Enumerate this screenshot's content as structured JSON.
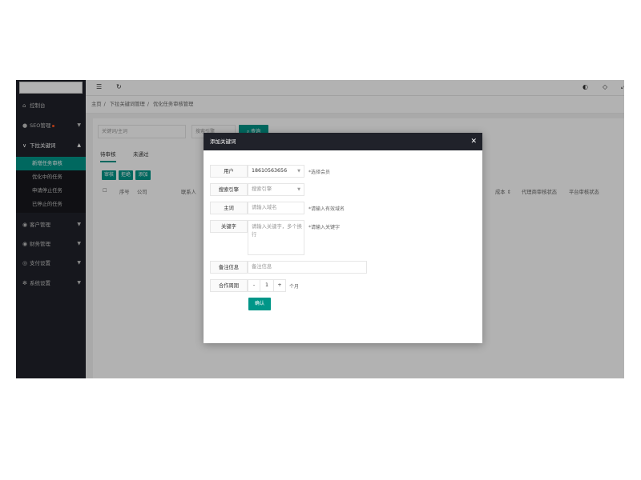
{
  "sidebar": {
    "items": [
      {
        "label": "控制台",
        "icon": "home-icon"
      },
      {
        "label": "SEO管理",
        "icon": "settings-icon"
      },
      {
        "label": "下拉关键词",
        "icon": "chevron-icon"
      },
      {
        "label": "客户管理",
        "icon": "user-icon"
      },
      {
        "label": "财务管理",
        "icon": "finance-icon"
      },
      {
        "label": "支付设置",
        "icon": "pay-icon"
      },
      {
        "label": "系统设置",
        "icon": "gear-icon"
      }
    ],
    "sub_items": [
      "新增任务审核",
      "优化中的任务",
      "申请停止任务",
      "已停止的任务"
    ]
  },
  "breadcrumb": [
    "主页",
    "下拉关键词管理",
    "优化任务审核管理"
  ],
  "toolbar": {
    "search_placeholder": "关键词/主词",
    "engine_placeholder": "搜索引擎",
    "search_button": "查询"
  },
  "tabs": [
    "待审核",
    "未通过"
  ],
  "actions": [
    "审核",
    "拒绝",
    "添加"
  ],
  "table_headers": [
    "序号",
    "公司",
    "联系人",
    "成本",
    "代理商审核状态",
    "平台审核状态"
  ],
  "modal": {
    "title": "添加关键词",
    "user_label": "用户",
    "user_value": "18610563656",
    "user_hint": "*选择会员",
    "engine_label": "搜索引擎",
    "engine_placeholder": "搜索引擎",
    "mainword_label": "主词",
    "mainword_placeholder": "请输入域名",
    "mainword_hint": "*请输入有效域名",
    "keyword_label": "关键字",
    "keyword_placeholder": "请输入关键字，多个换行",
    "keyword_hint": "*请输入关键字",
    "remark_label": "备注信息",
    "remark_placeholder": "备注信息",
    "period_label": "合作周期",
    "period_minus": "-",
    "period_value": "1",
    "period_plus": "+",
    "period_unit": "个月",
    "confirm_label": "确认"
  },
  "colors": {
    "accent": "#009688",
    "sidebar": "#20222a",
    "badge": "#ff5722"
  }
}
